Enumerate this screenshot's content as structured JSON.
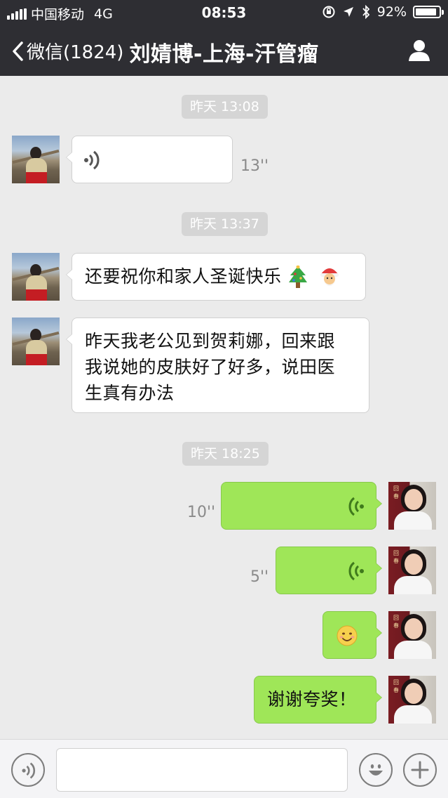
{
  "status_bar": {
    "carrier": "中国移动",
    "network": "4G",
    "time": "08:53",
    "battery_percent": "92%",
    "battery_level": 0.92
  },
  "nav": {
    "back_label": "微信(1824)",
    "title": "刘婧博-上海-汗管瘤"
  },
  "messages": {
    "ts1": "昨天 13:08",
    "voice1_duration": "13''",
    "ts2": "昨天 13:37",
    "text1": "还要祝你和家人圣诞快乐",
    "text1_emojis": [
      "christmas-tree-icon",
      "santa-face-icon"
    ],
    "text2_line1": "昨天我老公见到贺莉娜，回来跟",
    "text2_line2": "我说她的皮肤好了好多，说田医",
    "text2_line3": "生真有办法",
    "ts3": "昨天 18:25",
    "voice2_duration": "10''",
    "voice3_duration": "5''",
    "emoji_message": "smiling-face-icon",
    "text3": "谢谢夸奖！"
  },
  "doctor_avatar_text": "回春",
  "colors": {
    "header_bg": "#2e2e33",
    "chat_bg": "#ebebeb",
    "incoming_bubble": "#ffffff",
    "outgoing_bubble": "#9fe658",
    "timestamp_bg": "#d5d5d5"
  },
  "input_bar": {
    "voice_toggle_icon": "voice-icon",
    "emoji_icon": "emoji-icon",
    "more_icon": "plus-icon"
  }
}
